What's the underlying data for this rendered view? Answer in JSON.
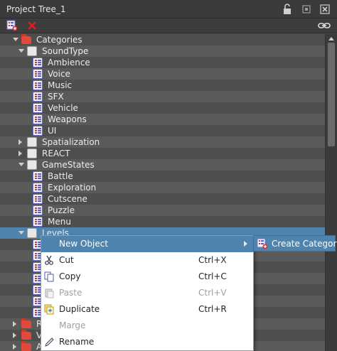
{
  "window": {
    "title": "Project Tree_1",
    "icons": [
      "lock-icon",
      "pin-icon",
      "close-icon"
    ]
  },
  "toolbar": {
    "buttons": [
      "new-category-icon",
      "delete-icon",
      "link-icon"
    ]
  },
  "tree": {
    "rows": [
      {
        "label": "Categories",
        "indent": 0,
        "icon": "folder",
        "expander": "down"
      },
      {
        "label": "SoundType",
        "indent": 1,
        "icon": "category",
        "expander": "down"
      },
      {
        "label": "Ambience",
        "indent": 2,
        "icon": "list"
      },
      {
        "label": "Voice",
        "indent": 2,
        "icon": "list"
      },
      {
        "label": "Music",
        "indent": 2,
        "icon": "list"
      },
      {
        "label": "SFX",
        "indent": 2,
        "icon": "list"
      },
      {
        "label": "Vehicle",
        "indent": 2,
        "icon": "list"
      },
      {
        "label": "Weapons",
        "indent": 2,
        "icon": "list"
      },
      {
        "label": "UI",
        "indent": 2,
        "icon": "list"
      },
      {
        "label": "Spatialization",
        "indent": 1,
        "icon": "category",
        "expander": "right"
      },
      {
        "label": "REACT",
        "indent": 1,
        "icon": "category",
        "expander": "right"
      },
      {
        "label": "GameStates",
        "indent": 1,
        "icon": "category",
        "expander": "down"
      },
      {
        "label": "Battle",
        "indent": 2,
        "icon": "list"
      },
      {
        "label": "Exploration",
        "indent": 2,
        "icon": "list"
      },
      {
        "label": "Cutscene",
        "indent": 2,
        "icon": "list"
      },
      {
        "label": "Puzzle",
        "indent": 2,
        "icon": "list"
      },
      {
        "label": "Menu",
        "indent": 2,
        "icon": "list"
      },
      {
        "label": "Levels",
        "indent": 1,
        "icon": "category",
        "expander": "down",
        "selected": true
      },
      {
        "label": "",
        "indent": 2,
        "icon": "list"
      },
      {
        "label": "",
        "indent": 2,
        "icon": "list"
      },
      {
        "label": "",
        "indent": 2,
        "icon": "list"
      },
      {
        "label": "",
        "indent": 2,
        "icon": "list"
      },
      {
        "label": "",
        "indent": 2,
        "icon": "list"
      },
      {
        "label": "",
        "indent": 2,
        "icon": "list"
      },
      {
        "label": "",
        "indent": 2,
        "icon": "list"
      },
      {
        "label": "R",
        "indent": 0,
        "icon": "folder",
        "expander": "right"
      },
      {
        "label": "V",
        "indent": 0,
        "icon": "folder",
        "expander": "right"
      },
      {
        "label": "A",
        "indent": 0,
        "icon": "folder",
        "expander": "right"
      }
    ]
  },
  "context_menu": {
    "items": [
      {
        "label": "New Object",
        "shortcut": "",
        "icon": "",
        "highlighted": true,
        "submenu": true
      },
      {
        "label": "Cut",
        "shortcut": "Ctrl+X",
        "icon": "scissors-icon"
      },
      {
        "label": "Copy",
        "shortcut": "Ctrl+C",
        "icon": "copy-icon"
      },
      {
        "label": "Paste",
        "shortcut": "Ctrl+V",
        "icon": "paste-icon",
        "disabled": true
      },
      {
        "label": "Duplicate",
        "shortcut": "Ctrl+R",
        "icon": "duplicate-icon"
      },
      {
        "label": "Marge",
        "shortcut": "",
        "icon": "",
        "disabled": true
      },
      {
        "label": "Rename",
        "shortcut": "",
        "icon": "pencil-icon"
      }
    ]
  },
  "submenu": {
    "item": "Create Category",
    "icon": "new-category-icon"
  },
  "colors": {
    "selection": "#4e84ad",
    "panel": "#4a4a4a",
    "folder": "#e04a3a"
  }
}
